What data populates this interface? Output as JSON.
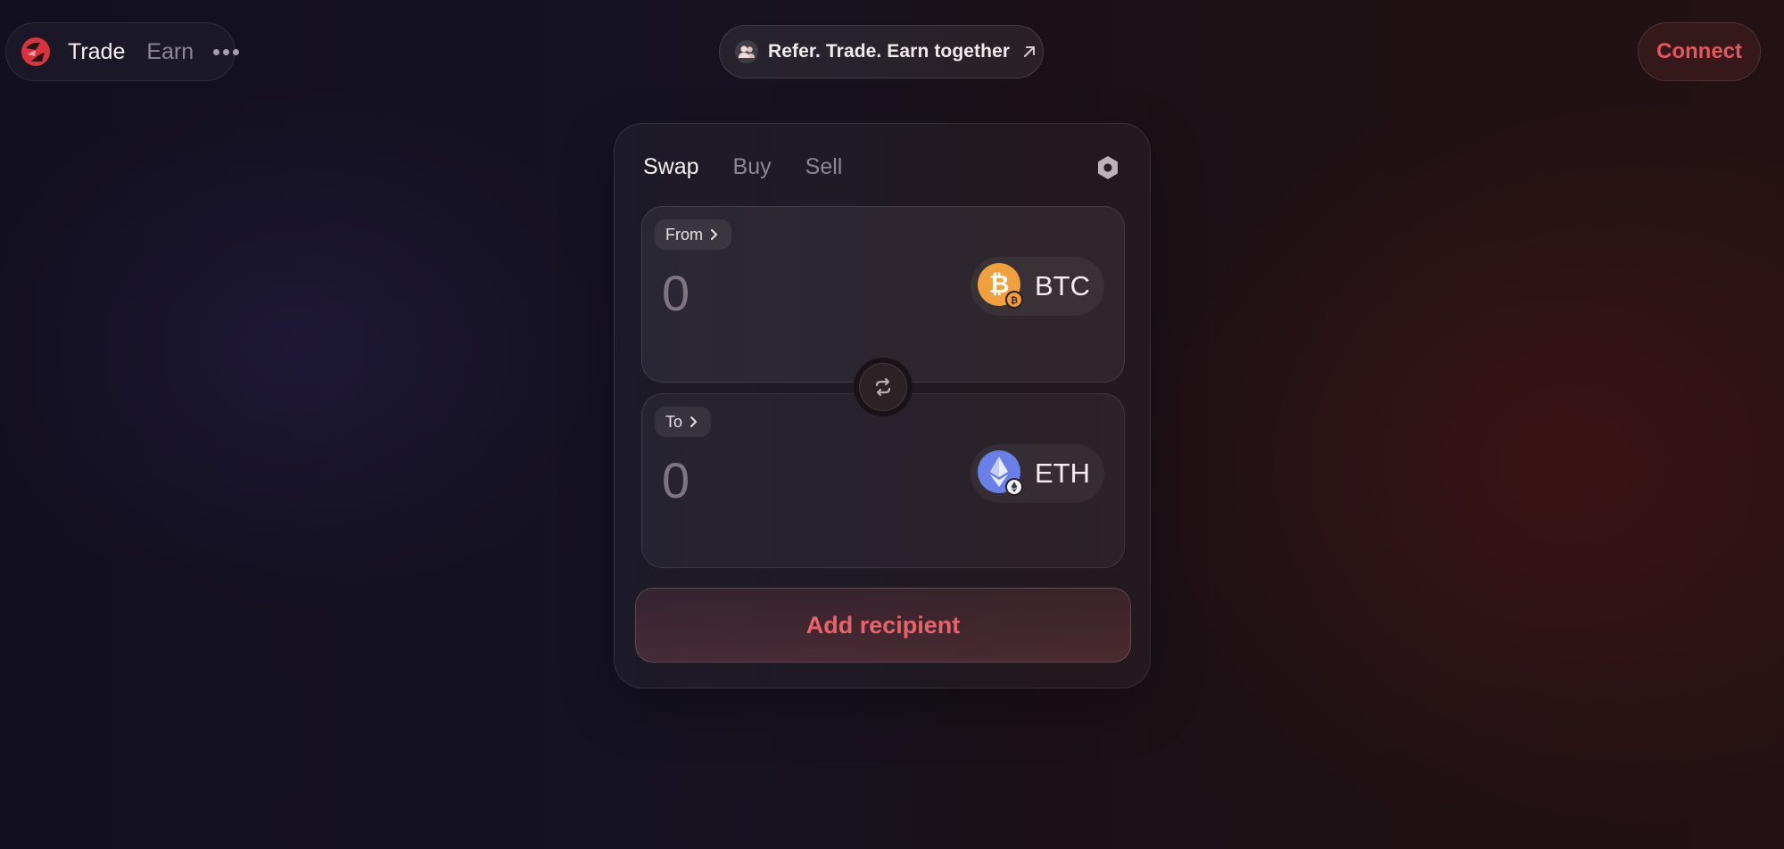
{
  "nav": {
    "logo": "brand-logo",
    "items": [
      {
        "label": "Trade",
        "active": true
      },
      {
        "label": "Earn",
        "active": false
      }
    ],
    "more_icon": "more-dots-icon"
  },
  "promo": {
    "text": "Refer. Trade. Earn together",
    "icon": "people-icon",
    "arrow_icon": "arrow-up-right-icon"
  },
  "connect": {
    "label": "Connect"
  },
  "swap_card": {
    "tabs": [
      {
        "label": "Swap",
        "active": true
      },
      {
        "label": "Buy",
        "active": false
      },
      {
        "label": "Sell",
        "active": false
      }
    ],
    "settings_icon": "settings-hexagon-icon",
    "from": {
      "label": "From",
      "amount": "0",
      "token": {
        "symbol": "BTC",
        "icon": "bitcoin-icon",
        "color": "#f7931a"
      }
    },
    "switch_icon": "swap-arrows-icon",
    "to": {
      "label": "To",
      "amount": "0",
      "token": {
        "symbol": "ETH",
        "icon": "ethereum-icon",
        "color": "#627eea"
      }
    },
    "cta": {
      "label": "Add recipient"
    }
  },
  "colors": {
    "accent": "#e4575e",
    "muted_text": "#8f8596"
  }
}
